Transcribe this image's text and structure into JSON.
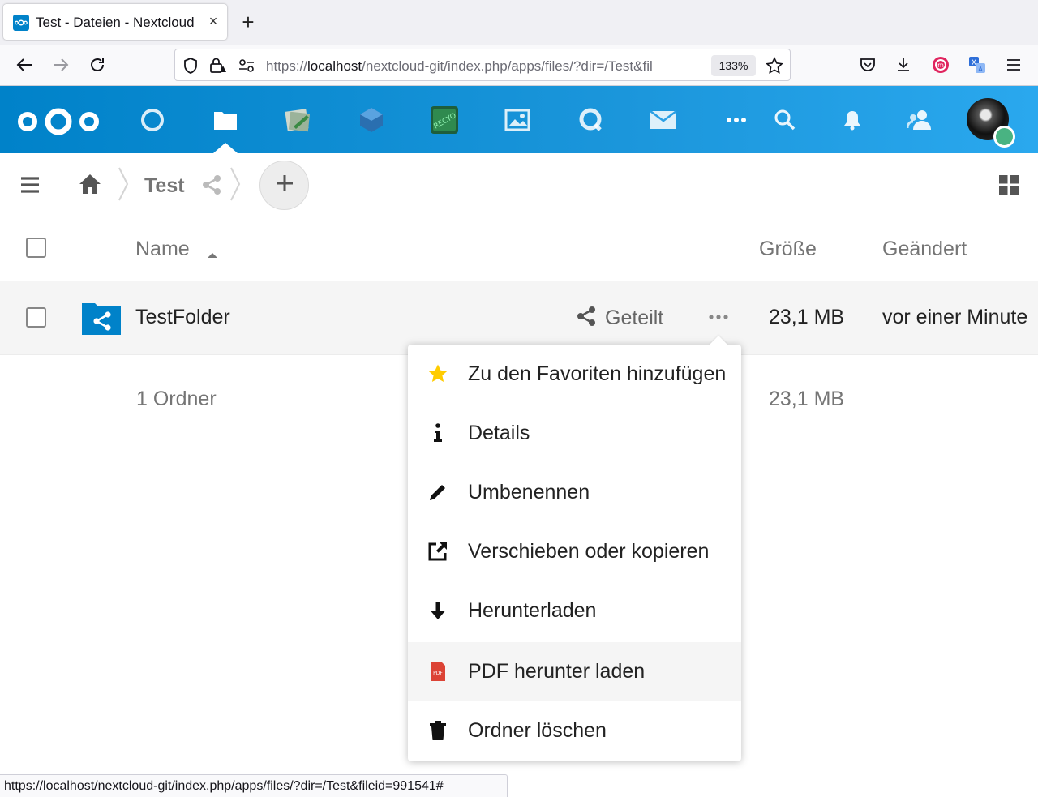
{
  "browser": {
    "tab_title": "Test - Dateien - Nextcloud",
    "close_glyph": "×",
    "new_tab_glyph": "+",
    "url_prefix": "https://",
    "url_host": "localhost",
    "url_rest": "/nextcloud-git/index.php/apps/files/?dir=/Test&fil",
    "zoom": "133%",
    "status_url": "https://localhost/nextcloud-git/index.php/apps/files/?dir=/Test&fileid=991541#"
  },
  "header": {
    "apps": [
      "dashboard-icon",
      "files-icon",
      "deck-icon",
      "collectives-icon",
      "ocr-icon",
      "photos-icon",
      "talk-icon",
      "mail-icon",
      "more-apps-icon"
    ],
    "accent": "#0082c9",
    "status_color": "#49b382"
  },
  "breadcrumb": {
    "current": "Test",
    "add_glyph": "+"
  },
  "table": {
    "columns": {
      "name": "Name",
      "size": "Größe",
      "modified": "Geändert"
    },
    "rows": [
      {
        "name": "TestFolder",
        "shared_label": "Geteilt",
        "size": "23,1 MB",
        "modified": "vor einer Minute"
      }
    ],
    "summary": {
      "count": "1 Ordner",
      "size": "23,1 MB"
    }
  },
  "menu": {
    "items": [
      {
        "icon": "star-icon",
        "label": "Zu den Favoriten hinzufügen"
      },
      {
        "icon": "info-icon",
        "label": "Details"
      },
      {
        "icon": "pencil-icon",
        "label": "Umbenennen"
      },
      {
        "icon": "external-icon",
        "label": "Verschieben oder kopieren"
      },
      {
        "icon": "download-icon",
        "label": "Herunterladen"
      },
      {
        "icon": "pdf-icon",
        "label": "PDF herunter laden"
      },
      {
        "icon": "trash-icon",
        "label": "Ordner löschen"
      }
    ]
  }
}
